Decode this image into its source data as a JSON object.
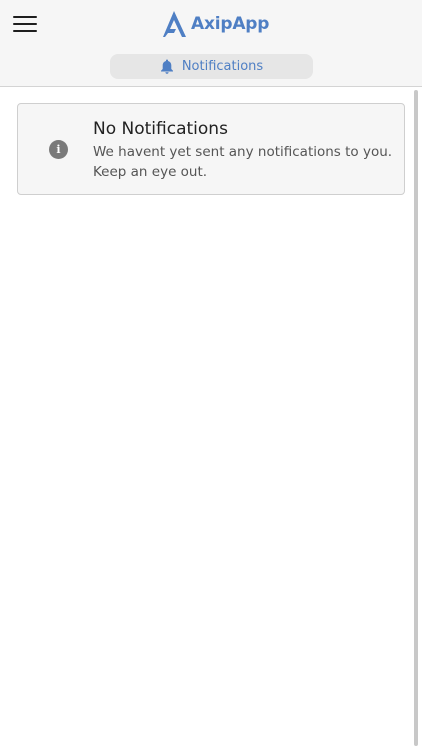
{
  "header": {
    "menu_icon": "hamburger-menu-icon",
    "logo_icon": "axipapp-logo-icon",
    "app_name": "AxipApp",
    "accent_color": "#4f7fc4"
  },
  "tab": {
    "icon": "bell-icon",
    "label": "Notifications"
  },
  "notice": {
    "icon": "info-icon",
    "title": "No Notifications",
    "message": "We havent yet sent any notifications to you. Keep an eye out."
  }
}
